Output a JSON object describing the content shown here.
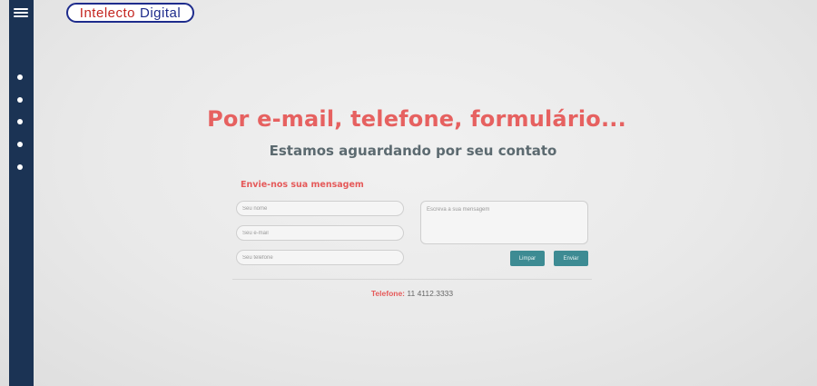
{
  "logo": {
    "word1": "Intelecto",
    "word2": "Digital"
  },
  "sidebar": {
    "menu_icon": "hamburger-icon",
    "nav_dots": 5
  },
  "hero": {
    "title": "Por e-mail, telefone, formulário...",
    "subtitle": "Estamos aguardando por seu contato"
  },
  "form": {
    "title": "Envie-nos sua mensagem",
    "name_placeholder": "Seu nome",
    "email_placeholder": "Seu e-mail",
    "phone_placeholder": "Seu telefone",
    "message_placeholder": "Escreva a sua mensagem",
    "clear_label": "Limpar",
    "send_label": "Enviar"
  },
  "contact": {
    "phone_label": "Telefone:",
    "phone_value": "11 4112.3333"
  },
  "colors": {
    "sidebar": "#1b3354",
    "accent": "#e66160",
    "button": "#3d8b93",
    "logo_red": "#c4251f",
    "logo_blue": "#1e2c8c"
  }
}
